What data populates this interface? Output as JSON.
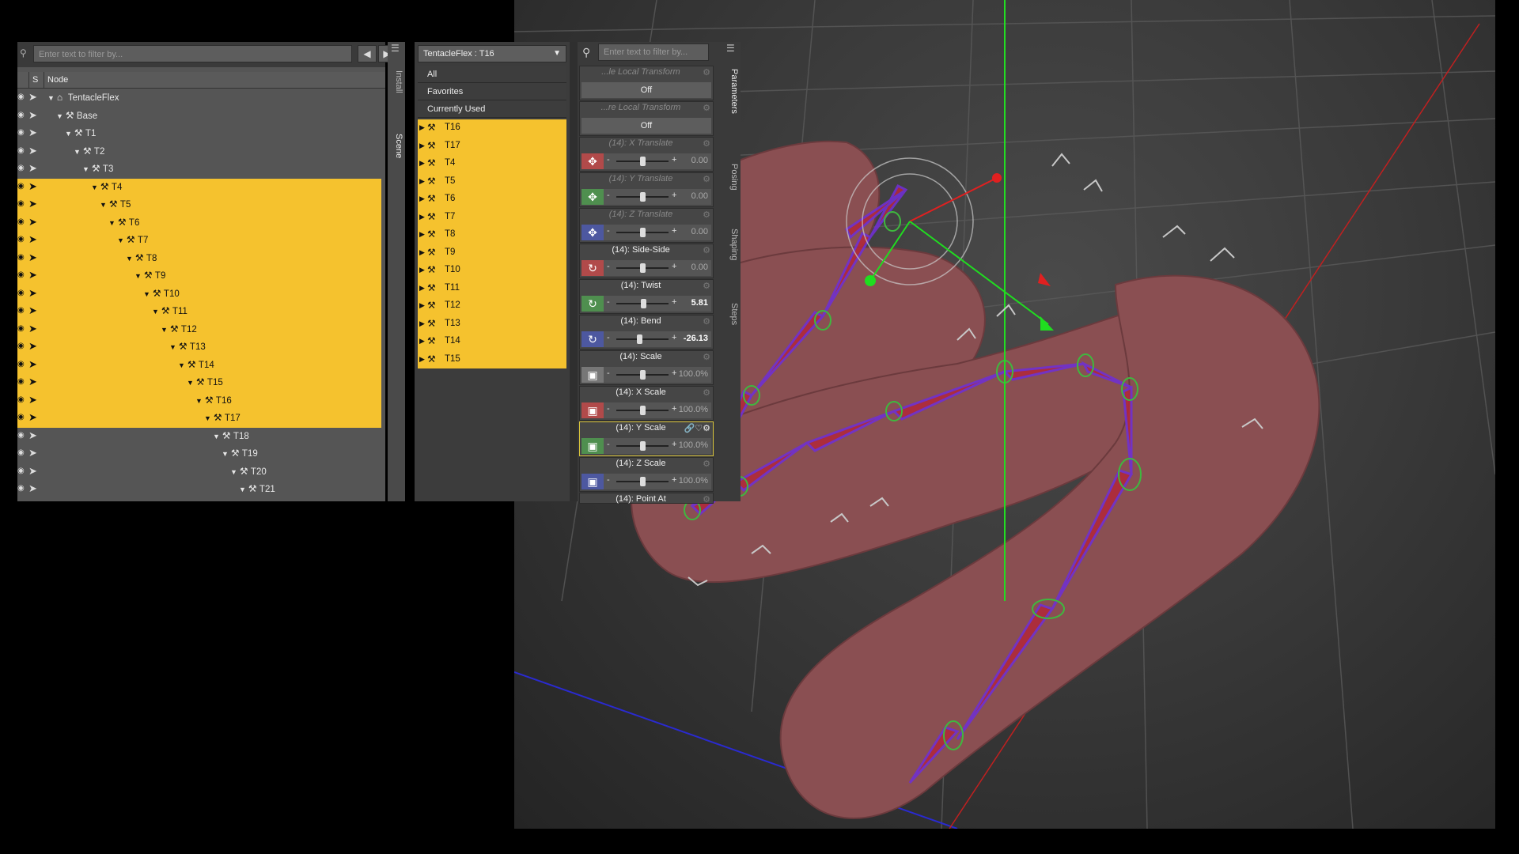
{
  "scene": {
    "filter_placeholder": "Enter text to filter by...",
    "col_s": "S",
    "col_node": "Node",
    "tabs": [
      "Install",
      "Scene"
    ],
    "nodes": [
      {
        "label": "TentacleFlex",
        "depth": 0,
        "icon": "figure-icon",
        "selected": false
      },
      {
        "label": "Base",
        "depth": 1,
        "icon": "bone-icon",
        "selected": false
      },
      {
        "label": "T1",
        "depth": 2,
        "icon": "bone-icon",
        "selected": false
      },
      {
        "label": "T2",
        "depth": 3,
        "icon": "bone-icon",
        "selected": false
      },
      {
        "label": "T3",
        "depth": 4,
        "icon": "bone-icon",
        "selected": false
      },
      {
        "label": "T4",
        "depth": 5,
        "icon": "bone-icon",
        "selected": true
      },
      {
        "label": "T5",
        "depth": 6,
        "icon": "bone-icon",
        "selected": true
      },
      {
        "label": "T6",
        "depth": 7,
        "icon": "bone-icon",
        "selected": true
      },
      {
        "label": "T7",
        "depth": 8,
        "icon": "bone-icon",
        "selected": true
      },
      {
        "label": "T8",
        "depth": 9,
        "icon": "bone-icon",
        "selected": true
      },
      {
        "label": "T9",
        "depth": 10,
        "icon": "bone-icon",
        "selected": true
      },
      {
        "label": "T10",
        "depth": 11,
        "icon": "bone-icon",
        "selected": true
      },
      {
        "label": "T11",
        "depth": 12,
        "icon": "bone-icon",
        "selected": true
      },
      {
        "label": "T12",
        "depth": 13,
        "icon": "bone-icon",
        "selected": true
      },
      {
        "label": "T13",
        "depth": 14,
        "icon": "bone-icon",
        "selected": true
      },
      {
        "label": "T14",
        "depth": 15,
        "icon": "bone-icon",
        "selected": true
      },
      {
        "label": "T15",
        "depth": 16,
        "icon": "bone-icon",
        "selected": true
      },
      {
        "label": "T16",
        "depth": 17,
        "icon": "bone-icon",
        "selected": true
      },
      {
        "label": "T17",
        "depth": 18,
        "icon": "bone-icon",
        "selected": true
      },
      {
        "label": "T18",
        "depth": 19,
        "icon": "bone-icon",
        "selected": false
      },
      {
        "label": "T19",
        "depth": 20,
        "icon": "bone-icon",
        "selected": false
      },
      {
        "label": "T20",
        "depth": 21,
        "icon": "bone-icon",
        "selected": false
      },
      {
        "label": "T21",
        "depth": 22,
        "icon": "bone-icon",
        "selected": false
      }
    ]
  },
  "properties": {
    "node_combo": "TentacleFlex : T16",
    "groups": [
      "All",
      "Favorites",
      "Currently Used"
    ],
    "bones": [
      "T16",
      "T17",
      "T4",
      "T5",
      "T6",
      "T7",
      "T8",
      "T9",
      "T10",
      "T11",
      "T12",
      "T13",
      "T14",
      "T15"
    ],
    "filter_placeholder": "Enter text to filter by...",
    "tabs": [
      "Parameters",
      "Posing",
      "Shaping",
      "Steps"
    ],
    "params": [
      {
        "label": "...le Local Transform",
        "kind": "button",
        "value": "Off",
        "dim": true
      },
      {
        "label": "...re Local Transform",
        "kind": "button",
        "value": "Off",
        "dim": true
      },
      {
        "label": "(14): X Translate",
        "kind": "slider",
        "value": "0.00",
        "icon": "translate-icon",
        "color": "#b14a4a",
        "knob": 0.5,
        "dim": true
      },
      {
        "label": "(14): Y Translate",
        "kind": "slider",
        "value": "0.00",
        "icon": "translate-icon",
        "color": "#4f8f4f",
        "knob": 0.5,
        "dim": true
      },
      {
        "label": "(14): Z Translate",
        "kind": "slider",
        "value": "0.00",
        "icon": "translate-icon",
        "color": "#4d58a0",
        "knob": 0.5,
        "dim": true
      },
      {
        "label": "(14): Side-Side",
        "kind": "slider",
        "value": "0.00",
        "icon": "rotate-icon",
        "color": "#b14a4a",
        "knob": 0.5,
        "dim": false
      },
      {
        "label": "(14): Twist",
        "kind": "slider",
        "value": "5.81",
        "icon": "rotate-icon",
        "color": "#4f8f4f",
        "knob": 0.52,
        "dim": false,
        "on": true
      },
      {
        "label": "(14): Bend",
        "kind": "slider",
        "value": "-26.13",
        "icon": "rotate-icon",
        "color": "#4d58a0",
        "knob": 0.44,
        "dim": false,
        "on": true
      },
      {
        "label": "(14): Scale",
        "kind": "slider",
        "value": "100.0%",
        "icon": "scale-icon",
        "color": "#777777",
        "knob": 0.5,
        "dim": false
      },
      {
        "label": "(14): X Scale",
        "kind": "slider",
        "value": "100.0%",
        "icon": "scale-icon",
        "color": "#b14a4a",
        "knob": 0.5,
        "dim": false
      },
      {
        "label": "(14): Y Scale",
        "kind": "slider",
        "value": "100.0%",
        "icon": "scale-icon",
        "color": "#4f8f4f",
        "knob": 0.5,
        "dim": false,
        "focus": true
      },
      {
        "label": "(14): Z Scale",
        "kind": "slider",
        "value": "100.0%",
        "icon": "scale-icon",
        "color": "#4d58a0",
        "knob": 0.5,
        "dim": false
      },
      {
        "label": "(14): Point At",
        "kind": "partial",
        "dim": false
      }
    ]
  },
  "colors": {
    "selection": "#f5c22e",
    "panel": "#555555",
    "viewport": "#3a3a3a"
  }
}
